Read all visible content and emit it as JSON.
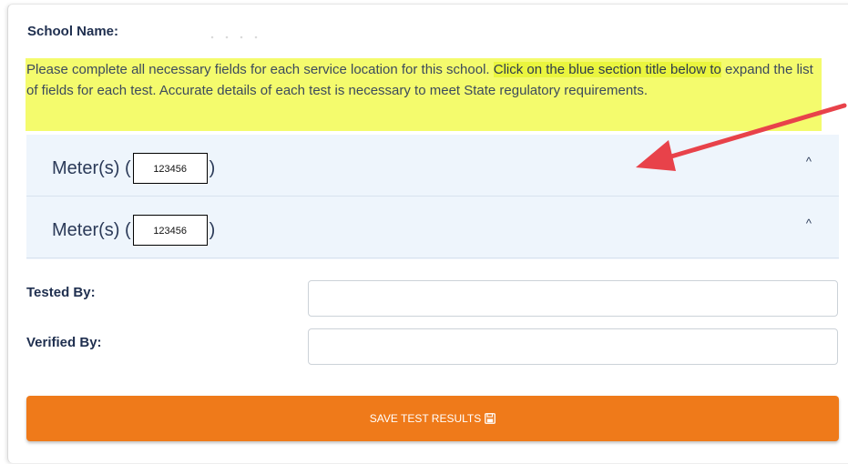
{
  "school": {
    "label": "School Name:",
    "value": ""
  },
  "notice": {
    "text_plain": "Please complete all necessary fields for each service location for this school. ",
    "text_highlight": "Click on the blue section title below to",
    "text_rest": " expand the list of fields for each test. Accurate details of each test is necessary to meet State regulatory requirements."
  },
  "meters": [
    {
      "prefix": "Meter(s) (",
      "value": "123456",
      "suffix": ")",
      "chevron": "^"
    },
    {
      "prefix": "Meter(s) (",
      "value": "123456",
      "suffix": ")",
      "chevron": "^"
    }
  ],
  "form": {
    "tested_by_label": "Tested By:",
    "tested_by_value": "",
    "verified_by_label": "Verified By:",
    "verified_by_value": ""
  },
  "save_button": {
    "label": "SAVE TEST RESULTS",
    "icon": "floppy-disk-icon"
  },
  "colors": {
    "highlight": "#f4fb6d",
    "accordion_bg": "#eef5fc",
    "button": "#ef7a1a",
    "arrow": "#e8424a"
  }
}
